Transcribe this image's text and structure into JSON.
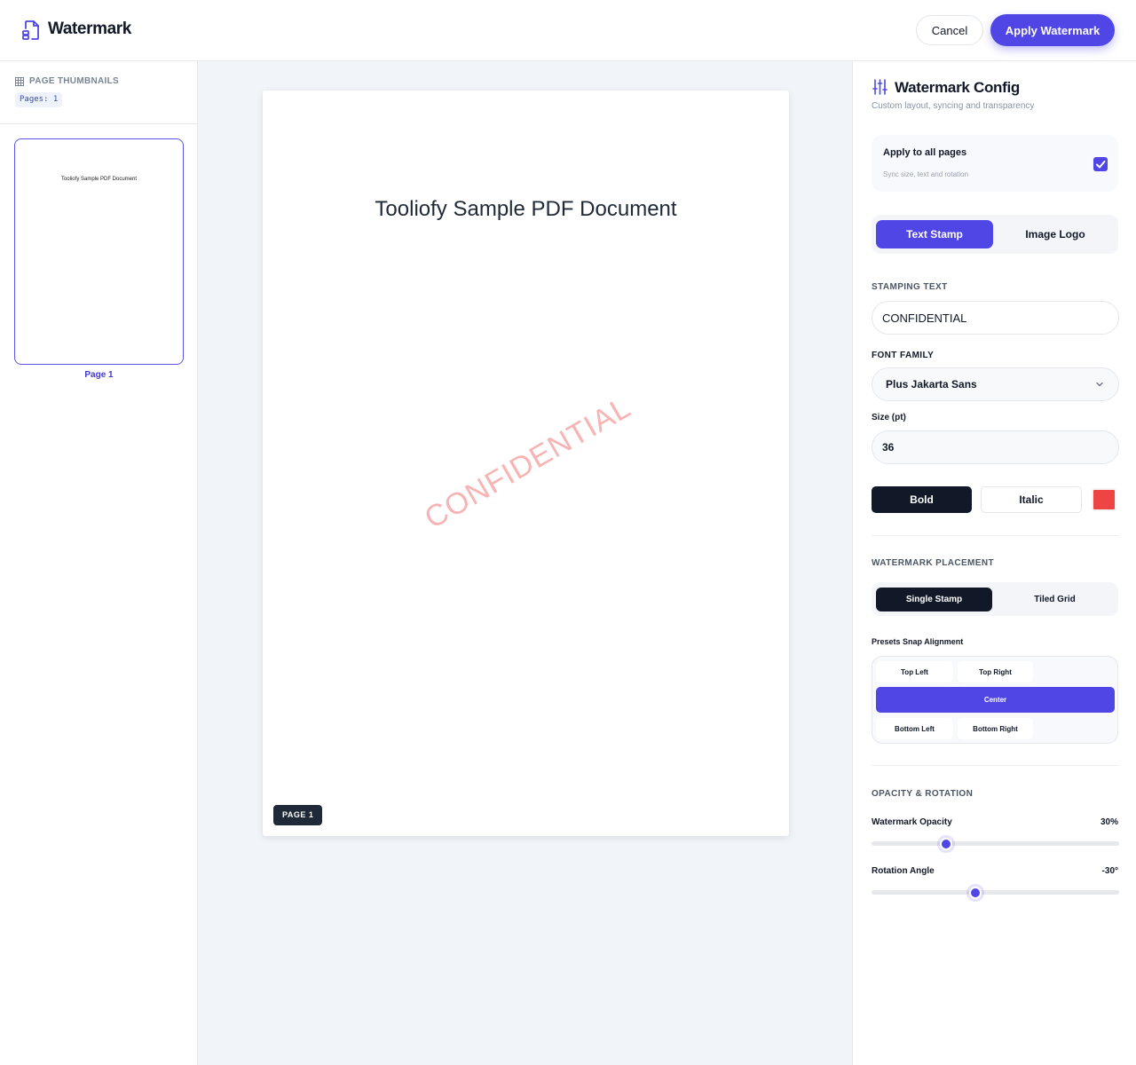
{
  "header": {
    "title": "Watermark",
    "cancel_label": "Cancel",
    "apply_label": "Apply Watermark"
  },
  "sidebar": {
    "title": "PAGE THUMBNAILS",
    "pages_badge": "Pages: 1",
    "thumbnails": [
      {
        "doc_text": "Tooliofy Sample PDF Document",
        "label": "Page 1"
      }
    ]
  },
  "canvas": {
    "document_title": "Tooliofy Sample PDF Document",
    "watermark_text": "CONFIDENTIAL",
    "page_pill": "PAGE 1"
  },
  "config": {
    "title": "Watermark Config",
    "subtitle": "Custom layout, syncing and transparency",
    "apply_all": {
      "label": "Apply to all pages",
      "sub": "Sync size, text and rotation",
      "checked": true
    },
    "mode_tabs": [
      "Text Stamp",
      "Image Logo"
    ],
    "active_mode": "Text Stamp",
    "stamping_text_label": "STAMPING TEXT",
    "stamping_text_value": "CONFIDENTIAL",
    "font_family_label": "FONT FAMILY",
    "font_family_value": "Plus Jakarta Sans",
    "size_label": "Size (pt)",
    "size_value": "36",
    "bold_label": "Bold",
    "italic_label": "Italic",
    "color": "#ef4444",
    "placement_label": "WATERMARK PLACEMENT",
    "placement_tabs": [
      "Single Stamp",
      "Tiled Grid"
    ],
    "active_placement": "Single Stamp",
    "snap_label": "Presets Snap Alignment",
    "snap_presets": [
      "Top Left",
      "Top Right",
      "Center",
      "Bottom Left",
      "Bottom Right"
    ],
    "active_snap": "Center",
    "opacity_section_label": "OPACITY & ROTATION",
    "opacity_label": "Watermark Opacity",
    "opacity_value": "30%",
    "opacity_fraction": 0.3,
    "rotation_label": "Rotation Angle",
    "rotation_value": "-30°",
    "rotation_degrees": -30,
    "rotation_fraction": 0.42
  },
  "colors": {
    "accent": "#4f46e5",
    "dark": "#111827",
    "watermark": "#ef4444"
  }
}
